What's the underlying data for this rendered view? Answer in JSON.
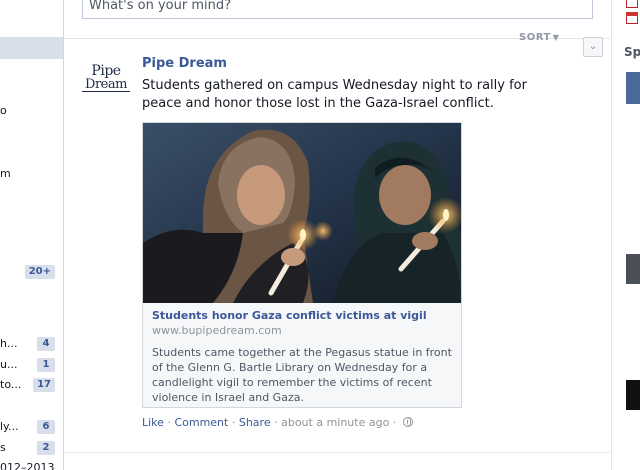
{
  "composer": {
    "placeholder": "What's on your mind?"
  },
  "feed": {
    "sort_label": "SORT"
  },
  "sidebar": {
    "fragments": [
      {
        "text": "o"
      },
      {
        "text": "m"
      },
      {
        "text": "h..."
      },
      {
        "text": "u..."
      },
      {
        "text": "to..."
      },
      {
        "text": "ly..."
      },
      {
        "text": "s"
      },
      {
        "text": "012–2013"
      }
    ],
    "counts": [
      "20+",
      "4",
      "1",
      "17",
      "6",
      "2"
    ]
  },
  "story": {
    "author": "Pipe Dream",
    "logo_line1": "Pipe",
    "logo_line2": "Dream",
    "text": "Students gathered on campus Wednesday night to rally for peace and honor those lost in the Gaza-Israel conflict.",
    "attachment": {
      "title": "Students honor Gaza conflict victims at vigil",
      "url": "www.bupipedream.com",
      "description": "Students came together at the Pegasus statue in front of the Glenn G. Bartle Library on Wednesday for a candlelight vigil to remember the victims of recent violence in Israel and Gaza."
    },
    "actions": {
      "like": "Like",
      "comment": "Comment",
      "share": "Share",
      "timestamp": "about a minute ago"
    }
  },
  "right_rail": {
    "heading_fragment": "Spo"
  },
  "colors": {
    "link": "#3b5998",
    "meta": "#90949c",
    "border": "#d3d6db",
    "sidebar_highlight": "#d8dfea"
  }
}
